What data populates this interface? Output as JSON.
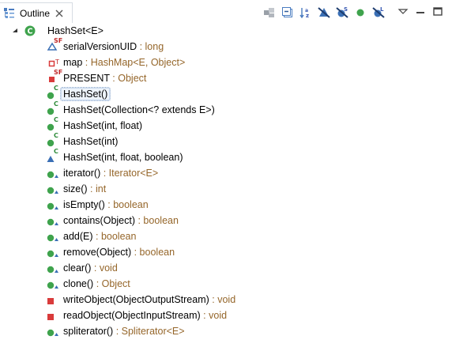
{
  "tab": {
    "title": "Outline",
    "icon": "outline-view-icon"
  },
  "toolbar": [
    {
      "name": "sync-icon",
      "title": ""
    },
    {
      "name": "collapse-all-icon",
      "title": ""
    },
    {
      "name": "sort-az-icon",
      "title": ""
    },
    {
      "name": "hide-fields-icon",
      "title": ""
    },
    {
      "name": "hide-static-icon",
      "title": ""
    },
    {
      "name": "hide-nonpublic-icon",
      "title": ""
    },
    {
      "name": "hide-local-types-icon",
      "title": ""
    }
  ],
  "window_controls": [
    "view-menu-icon",
    "minimize-icon",
    "maximize-icon"
  ],
  "tree": {
    "root": {
      "label": "HashSet<E>",
      "kind": "class",
      "expanded": true
    },
    "items": [
      {
        "name": "serialVersionUID",
        "type": " : long",
        "kind": "field-private-static-final",
        "mods": "SF"
      },
      {
        "name": "map",
        "type": " : HashMap<E, Object>",
        "kind": "field-private-transient",
        "mods": "T"
      },
      {
        "name": "PRESENT",
        "type": " : Object",
        "kind": "field-private-static-final-red",
        "mods": "SF"
      },
      {
        "name": "HashSet()",
        "type": "",
        "kind": "constructor-public",
        "mods": "C",
        "selected": true
      },
      {
        "name": "HashSet(Collection<? extends E>)",
        "type": "",
        "kind": "constructor-public",
        "mods": "C"
      },
      {
        "name": "HashSet(int, float)",
        "type": "",
        "kind": "constructor-public",
        "mods": "C"
      },
      {
        "name": "HashSet(int)",
        "type": "",
        "kind": "constructor-public",
        "mods": "C"
      },
      {
        "name": "HashSet(int, float, boolean)",
        "type": "",
        "kind": "constructor-default",
        "mods": "C"
      },
      {
        "name": "iterator()",
        "type": " : Iterator<E>",
        "kind": "method-public-override",
        "mods": ""
      },
      {
        "name": "size()",
        "type": " : int",
        "kind": "method-public-override",
        "mods": ""
      },
      {
        "name": "isEmpty()",
        "type": " : boolean",
        "kind": "method-public-override",
        "mods": ""
      },
      {
        "name": "contains(Object)",
        "type": " : boolean",
        "kind": "method-public-override",
        "mods": ""
      },
      {
        "name": "add(E)",
        "type": " : boolean",
        "kind": "method-public-override",
        "mods": ""
      },
      {
        "name": "remove(Object)",
        "type": " : boolean",
        "kind": "method-public-override",
        "mods": ""
      },
      {
        "name": "clear()",
        "type": " : void",
        "kind": "method-public-override",
        "mods": ""
      },
      {
        "name": "clone()",
        "type": " : Object",
        "kind": "method-public-override",
        "mods": ""
      },
      {
        "name": "writeObject(ObjectOutputStream)",
        "type": " : void",
        "kind": "method-private",
        "mods": ""
      },
      {
        "name": "readObject(ObjectInputStream)",
        "type": " : void",
        "kind": "method-private",
        "mods": ""
      },
      {
        "name": "spliterator()",
        "type": " : Spliterator<E>",
        "kind": "method-public-override",
        "mods": ""
      }
    ]
  },
  "colors": {
    "public_green": "#3fa34d",
    "private_red": "#d93b3b",
    "default_blue": "#3a6fb5",
    "type_brown": "#95662a",
    "modifier_green": "#2e8b3a",
    "modifier_red": "#c02a2a",
    "modifier_blue": "#3858b3"
  }
}
